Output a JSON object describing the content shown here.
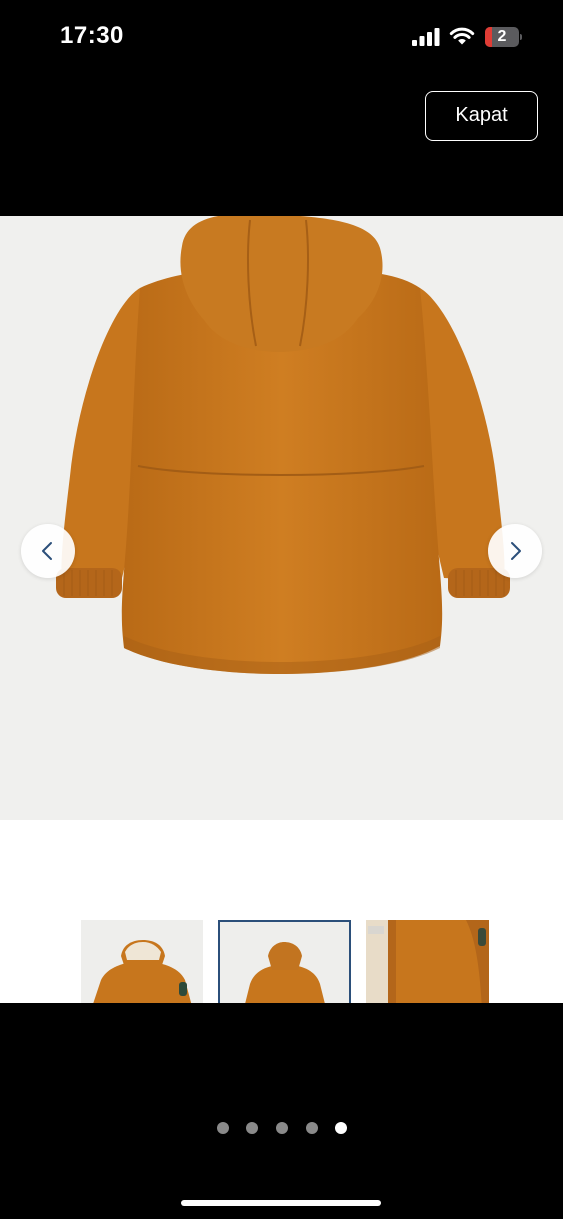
{
  "status_bar": {
    "time": "17:30",
    "battery_label": "2",
    "battery_level": 0.2,
    "battery_color": "#e03c35",
    "icons": [
      "signal-icon",
      "wifi-icon",
      "battery-icon"
    ]
  },
  "header": {
    "close_label": "Kapat"
  },
  "gallery": {
    "main_image": "orange-hooded-parka-back-view",
    "prev_icon": "chevron-left-icon",
    "next_icon": "chevron-right-icon",
    "thumbnails": [
      {
        "image": "orange-parka-front-fur-hood",
        "selected": false
      },
      {
        "image": "orange-parka-back-view",
        "selected": true
      },
      {
        "image": "orange-parka-closeup-detail",
        "selected": false
      }
    ]
  },
  "pagination": {
    "total": 5,
    "active_index": 4
  },
  "colors": {
    "jacket": "#c8781e",
    "background": "#f0f0ee",
    "selected_thumb_border": "#2b4f7a"
  }
}
